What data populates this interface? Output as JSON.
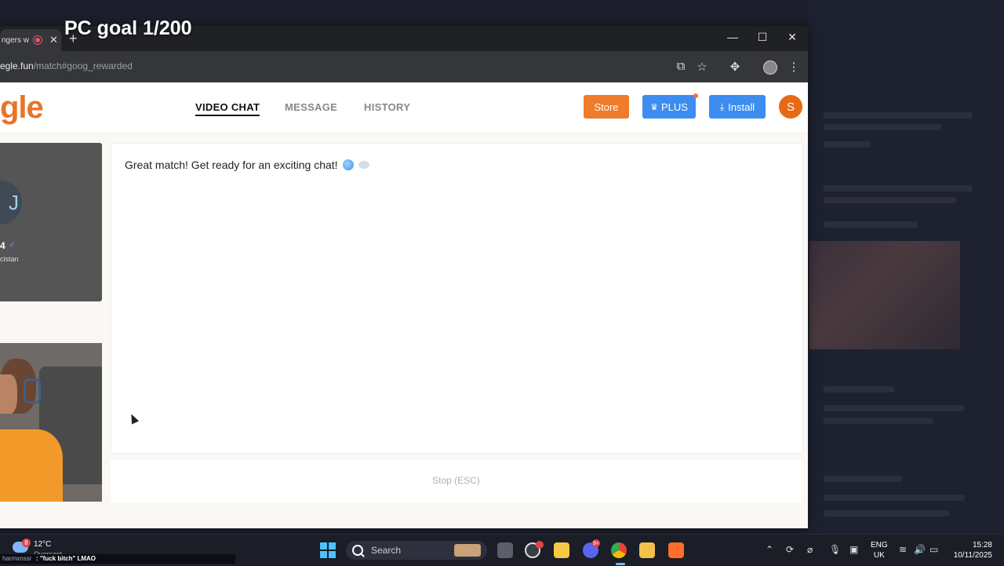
{
  "overlay": {
    "title": "PC goal 1/200"
  },
  "browser": {
    "tab_title": "ngers w",
    "tab_close": "✕",
    "new_tab": "+",
    "window_controls": {
      "minimize": "—",
      "maximize": "☐",
      "close": "✕"
    },
    "url_host": "egle.fun",
    "url_path": "/match#goog_rewarded"
  },
  "site": {
    "logo": "gle",
    "nav": {
      "video_chat": "VIDEO CHAT",
      "message": "MESSAGE",
      "history": "HISTORY"
    },
    "buttons": {
      "store": "Store",
      "plus": "PLUS",
      "install": "Install"
    },
    "avatar_initial": "S"
  },
  "stranger": {
    "initial": "J",
    "age": "4",
    "gender_icon": "♂",
    "location": "cistan"
  },
  "chat": {
    "message": "Great match! Get ready for an exciting chat!",
    "stop_label": "Stop (ESC)"
  },
  "taskbar": {
    "weather_temp": "12°C",
    "weather_sub": "Overcast",
    "weather_badge": "8",
    "search_placeholder": "Search",
    "discord_badge": "9+",
    "lang_top": "ENG",
    "lang_bottom": "UK",
    "time": "15:28",
    "date": "10/11/2025"
  },
  "stream_chat": {
    "user": "harmxnssr",
    "text": ": \"fuck bitch\" LMAO"
  },
  "colors": {
    "accent_orange": "#ef7b2d",
    "accent_blue": "#3d8cf0",
    "logo": "#e8742a"
  }
}
